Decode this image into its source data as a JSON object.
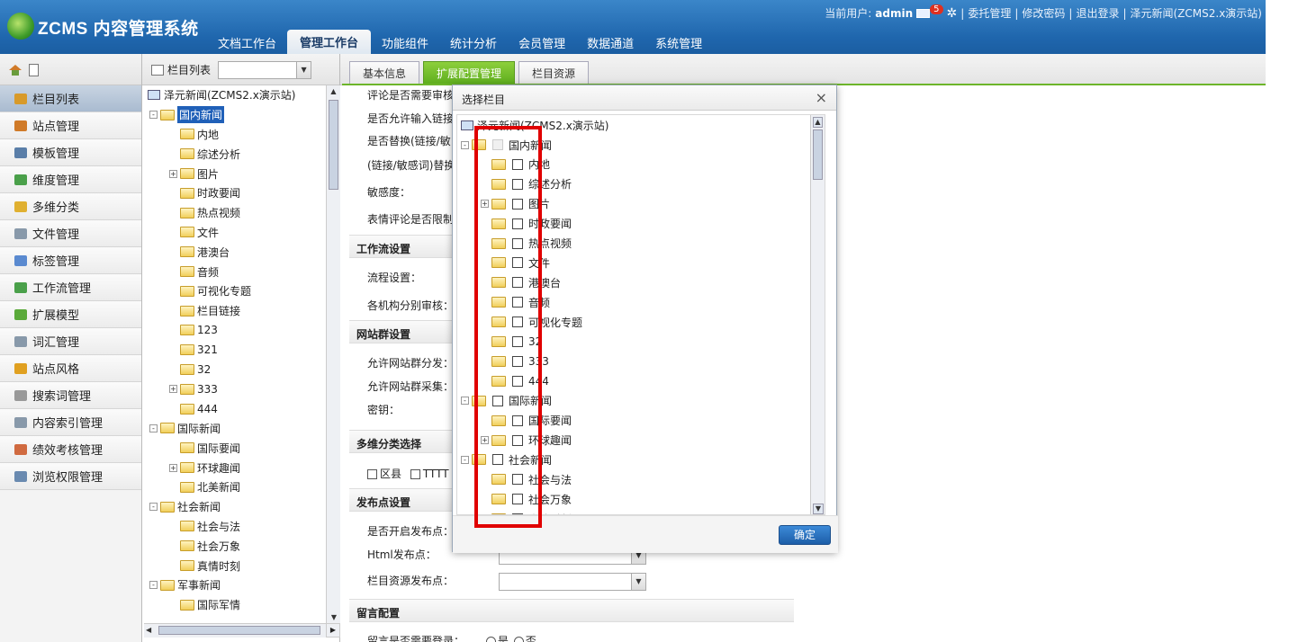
{
  "header": {
    "logo_text": "ZCMS 内容管理系统",
    "user_prefix": "当前用户:",
    "username": "admin",
    "mail_count": "5",
    "links": [
      "委托管理",
      "修改密码",
      "退出登录",
      "泽元新闻(ZCMS2.x演示站)"
    ],
    "nav": [
      "文档工作台",
      "管理工作台",
      "功能组件",
      "统计分析",
      "会员管理",
      "数据通道",
      "系统管理"
    ],
    "active_nav": "管理工作台"
  },
  "toolbar": {
    "catalog_list_label": "栏目列表",
    "tabs": [
      "基本信息",
      "扩展配置管理",
      "栏目资源"
    ],
    "active_tab": "扩展配置管理"
  },
  "sidebar": {
    "items": [
      {
        "label": "栏目列表",
        "icon": "catalog-icon",
        "color": "#d89a2a"
      },
      {
        "label": "站点管理",
        "icon": "house-icon",
        "color": "#d07a28"
      },
      {
        "label": "模板管理",
        "icon": "template-icon",
        "color": "#5a7ea8"
      },
      {
        "label": "维度管理",
        "icon": "dimension-icon",
        "color": "#4aa04a"
      },
      {
        "label": "多维分类",
        "icon": "folder-icon",
        "color": "#e0b030"
      },
      {
        "label": "文件管理",
        "icon": "file-icon",
        "color": "#8899aa"
      },
      {
        "label": "标签管理",
        "icon": "tag-icon",
        "color": "#5a8ad0"
      },
      {
        "label": "工作流管理",
        "icon": "workflow-icon",
        "color": "#4aa04a"
      },
      {
        "label": "扩展模型",
        "icon": "puzzle-icon",
        "color": "#5aaa3a"
      },
      {
        "label": "词汇管理",
        "icon": "glossary-icon",
        "color": "#8899aa"
      },
      {
        "label": "站点风格",
        "icon": "palette-icon",
        "color": "#e0a020"
      },
      {
        "label": "搜索词管理",
        "icon": "search-icon",
        "color": "#999999"
      },
      {
        "label": "内容索引管理",
        "icon": "index-icon",
        "color": "#8899aa"
      },
      {
        "label": "绩效考核管理",
        "icon": "performance-icon",
        "color": "#d06a40"
      },
      {
        "label": "浏览权限管理",
        "icon": "permission-icon",
        "color": "#6a8ab0"
      }
    ]
  },
  "tree": {
    "root": "泽元新闻(ZCMS2.x演示站)",
    "nodes": [
      {
        "label": "国内新闻",
        "level": 1,
        "expand": "-",
        "selected": true
      },
      {
        "label": "内地",
        "level": 2
      },
      {
        "label": "综述分析",
        "level": 2
      },
      {
        "label": "图片",
        "level": 2,
        "expand": "+"
      },
      {
        "label": "时政要闻",
        "level": 2
      },
      {
        "label": "热点视频",
        "level": 2
      },
      {
        "label": "文件",
        "level": 2
      },
      {
        "label": "港澳台",
        "level": 2
      },
      {
        "label": "音频",
        "level": 2
      },
      {
        "label": "可视化专题",
        "level": 2
      },
      {
        "label": "栏目链接",
        "level": 2
      },
      {
        "label": "123",
        "level": 2
      },
      {
        "label": "321",
        "level": 2
      },
      {
        "label": "32",
        "level": 2
      },
      {
        "label": "333",
        "level": 2,
        "expand": "+"
      },
      {
        "label": "444",
        "level": 2
      },
      {
        "label": "国际新闻",
        "level": 1,
        "expand": "-"
      },
      {
        "label": "国际要闻",
        "level": 2
      },
      {
        "label": "环球趣闻",
        "level": 2,
        "expand": "+"
      },
      {
        "label": "北美新闻",
        "level": 2
      },
      {
        "label": "社会新闻",
        "level": 1,
        "expand": "-"
      },
      {
        "label": "社会与法",
        "level": 2
      },
      {
        "label": "社会万象",
        "level": 2
      },
      {
        "label": "真情时刻",
        "level": 2
      },
      {
        "label": "军事新闻",
        "level": 1,
        "expand": "-"
      },
      {
        "label": "国际军情",
        "level": 2
      }
    ]
  },
  "form": {
    "rows_top": [
      "评论是否需要审核",
      "是否允许输入链接",
      "是否替换(链接/敏",
      "(链接/敏感词)替换",
      "敏感度：",
      "表情评论是否限制"
    ],
    "section_workflow": "工作流设置",
    "workflow_rows": [
      "流程设置：",
      "各机构分别审核："
    ],
    "section_sitegroup": "网站群设置",
    "sitegroup_rows": [
      "允许网站群分发：",
      "允许网站群采集：",
      "密钥："
    ],
    "section_multidim": "多维分类选择",
    "multidim_options": [
      "区县",
      "TTTT"
    ],
    "section_publish": "发布点设置",
    "publish_rows": [
      "是否开启发布点：",
      "Html发布点：",
      "栏目资源发布点："
    ],
    "section_message": "留言配置",
    "message_row": "留言是否需要登录：",
    "radio_yes": "是",
    "radio_no": "否"
  },
  "dialog": {
    "title": "选择栏目",
    "root": "泽元新闻(ZCMS2.x演示站)",
    "ok_label": "确定",
    "highlight_color": "#e00000",
    "nodes": [
      {
        "label": "国内新闻",
        "level": 1,
        "expand": "-",
        "disabled": true
      },
      {
        "label": "内地",
        "level": 2
      },
      {
        "label": "综述分析",
        "level": 2
      },
      {
        "label": "图片",
        "level": 2,
        "expand": "+"
      },
      {
        "label": "时政要闻",
        "level": 2
      },
      {
        "label": "热点视频",
        "level": 2
      },
      {
        "label": "文件",
        "level": 2
      },
      {
        "label": "港澳台",
        "level": 2
      },
      {
        "label": "音频",
        "level": 2
      },
      {
        "label": "可视化专题",
        "level": 2
      },
      {
        "label": "32",
        "level": 2
      },
      {
        "label": "333",
        "level": 2
      },
      {
        "label": "444",
        "level": 2
      },
      {
        "label": "国际新闻",
        "level": 1,
        "expand": "-"
      },
      {
        "label": "国际要闻",
        "level": 2
      },
      {
        "label": "环球趣闻",
        "level": 2,
        "expand": "+"
      },
      {
        "label": "社会新闻",
        "level": 1,
        "expand": "-"
      },
      {
        "label": "社会与法",
        "level": 2
      },
      {
        "label": "社会万象",
        "level": 2
      },
      {
        "label": "真情时刻",
        "level": 2
      }
    ]
  }
}
